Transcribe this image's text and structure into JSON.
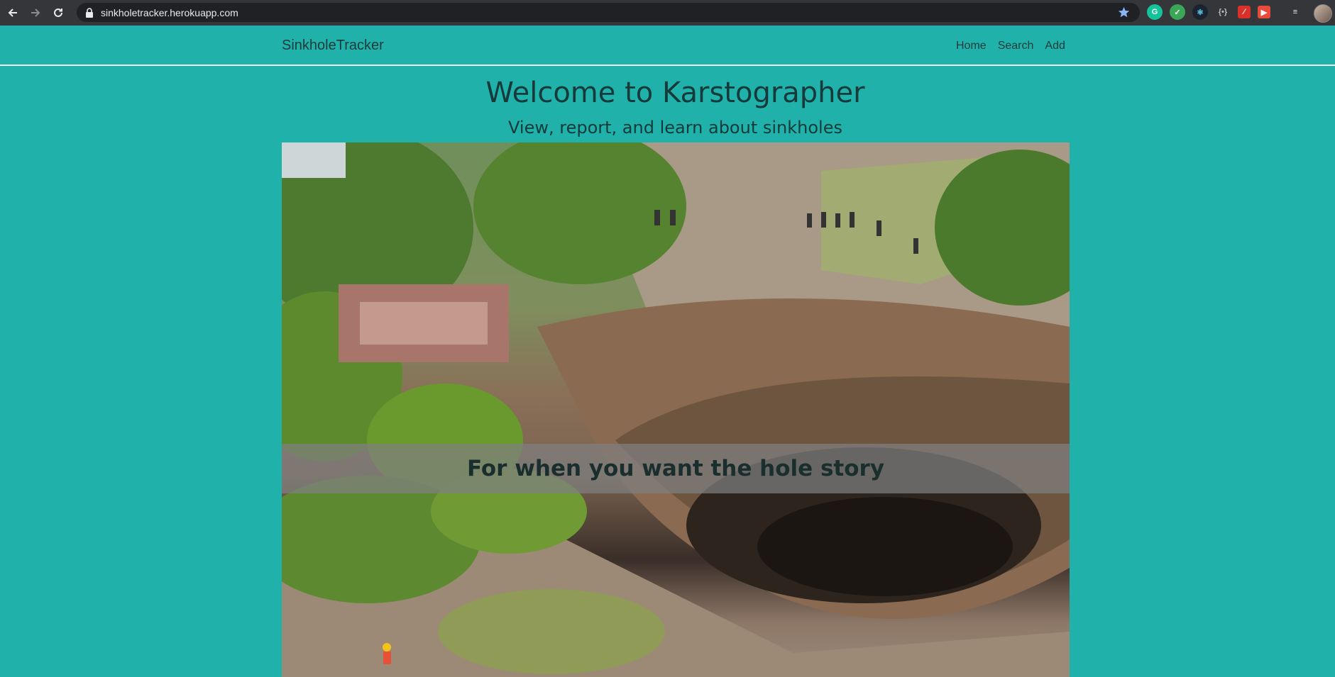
{
  "browser": {
    "url": "sinkholetracker.herokuapp.com",
    "icons": [
      "back-arrow-icon",
      "forward-arrow-icon",
      "reload-icon",
      "lock-icon",
      "bookmark-star-icon",
      "grammarly-icon",
      "checkmark-extension-icon",
      "react-devtools-icon",
      "code-extension-icon",
      "pdf-extension-icon",
      "video-extension-icon",
      "reading-list-icon",
      "profile-avatar"
    ]
  },
  "navbar": {
    "brand": "SinkholeTracker",
    "links": [
      {
        "label": "Home"
      },
      {
        "label": "Search"
      },
      {
        "label": "Add"
      }
    ]
  },
  "hero": {
    "title": "Welcome to Karstographer",
    "subtitle": "View, report, and learn about sinkholes",
    "caption": "For when you want the hole story"
  },
  "colors": {
    "page_background": "#20b2aa",
    "text_dark": "#16393a",
    "chrome": "#35363a",
    "omnibox": "#202124"
  }
}
